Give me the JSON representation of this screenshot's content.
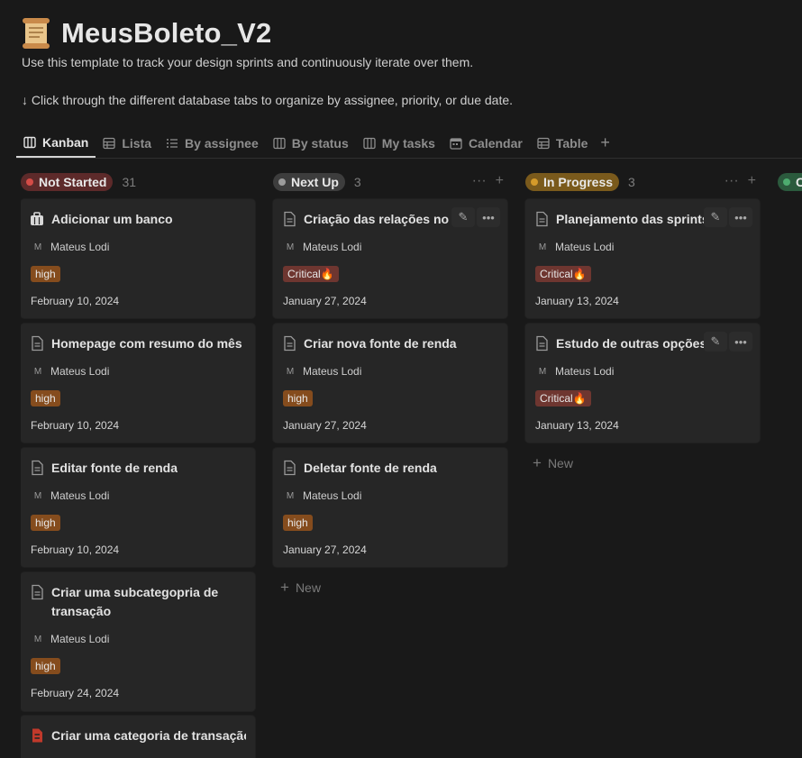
{
  "page": {
    "icon": "scroll-icon",
    "title": "MeusBoleto_V2",
    "description": "Use this template to track your design sprints and continuously iterate over them.",
    "hint": "↓ Click through the different database tabs to organize by assignee, priority, or due date."
  },
  "tabs": [
    {
      "label": "Kanban",
      "icon": "board-icon",
      "active": true
    },
    {
      "label": "Lista",
      "icon": "table-icon"
    },
    {
      "label": "By assignee",
      "icon": "list-icon"
    },
    {
      "label": "By status",
      "icon": "board-icon"
    },
    {
      "label": "My tasks",
      "icon": "board-icon"
    },
    {
      "label": "Calendar",
      "icon": "calendar-icon"
    },
    {
      "label": "Table",
      "icon": "table-icon"
    }
  ],
  "tab_add": "+",
  "colors": {
    "not_started": "#5d2a2a",
    "next_up": "#3d3d3d",
    "in_progress": "#7a5a1c",
    "done": "#2b5a3d",
    "high": "#854c1d",
    "critical": "#6e3630"
  },
  "columns": [
    {
      "status": "Not Started",
      "count": "31",
      "cards": [
        {
          "title": "Adicionar um banco",
          "icon": "briefcase-icon",
          "assignee_initial": "M",
          "assignee": "Mateus Lodi",
          "priority": "high",
          "date": "February 10, 2024"
        },
        {
          "title": "Homepage com resumo do mês",
          "icon": "page-icon",
          "assignee_initial": "M",
          "assignee": "Mateus Lodi",
          "priority": "high",
          "date": "February 10, 2024"
        },
        {
          "title": "Editar fonte de renda",
          "icon": "page-icon",
          "assignee_initial": "M",
          "assignee": "Mateus Lodi",
          "priority": "high",
          "date": "February 10, 2024"
        },
        {
          "title": "Criar uma subcategopria de transação",
          "icon": "page-icon",
          "assignee_initial": "M",
          "assignee": "Mateus Lodi",
          "priority": "high",
          "date": "February 24, 2024"
        },
        {
          "title": "Criar uma categoria de transação",
          "icon": "red-file-icon"
        }
      ]
    },
    {
      "status": "Next Up",
      "count": "3",
      "cards": [
        {
          "title": "Criação das relações no DB",
          "icon": "page-icon",
          "assignee_initial": "M",
          "assignee": "Mateus Lodi",
          "priority": "Critical🔥",
          "date": "January 27, 2024"
        },
        {
          "title": "Criar nova fonte de renda",
          "icon": "page-icon",
          "assignee_initial": "M",
          "assignee": "Mateus Lodi",
          "priority": "high",
          "date": "January 27, 2024"
        },
        {
          "title": "Deletar fonte de renda",
          "icon": "page-icon",
          "assignee_initial": "M",
          "assignee": "Mateus Lodi",
          "priority": "high",
          "date": "January 27, 2024"
        }
      ],
      "new_label": "New"
    },
    {
      "status": "In Progress",
      "count": "3",
      "cards": [
        {
          "title": "Planejamento das sprints",
          "icon": "page-icon",
          "assignee_initial": "M",
          "assignee": "Mateus Lodi",
          "priority": "Critical🔥",
          "date": "January 13, 2024"
        },
        {
          "title": "Estudo de outras opções",
          "icon": "page-icon",
          "assignee_initial": "M",
          "assignee": "Mateus Lodi",
          "priority": "Critical🔥",
          "date": "January 13, 2024"
        }
      ],
      "new_label": "New"
    },
    {
      "status": "C",
      "count": ""
    }
  ]
}
